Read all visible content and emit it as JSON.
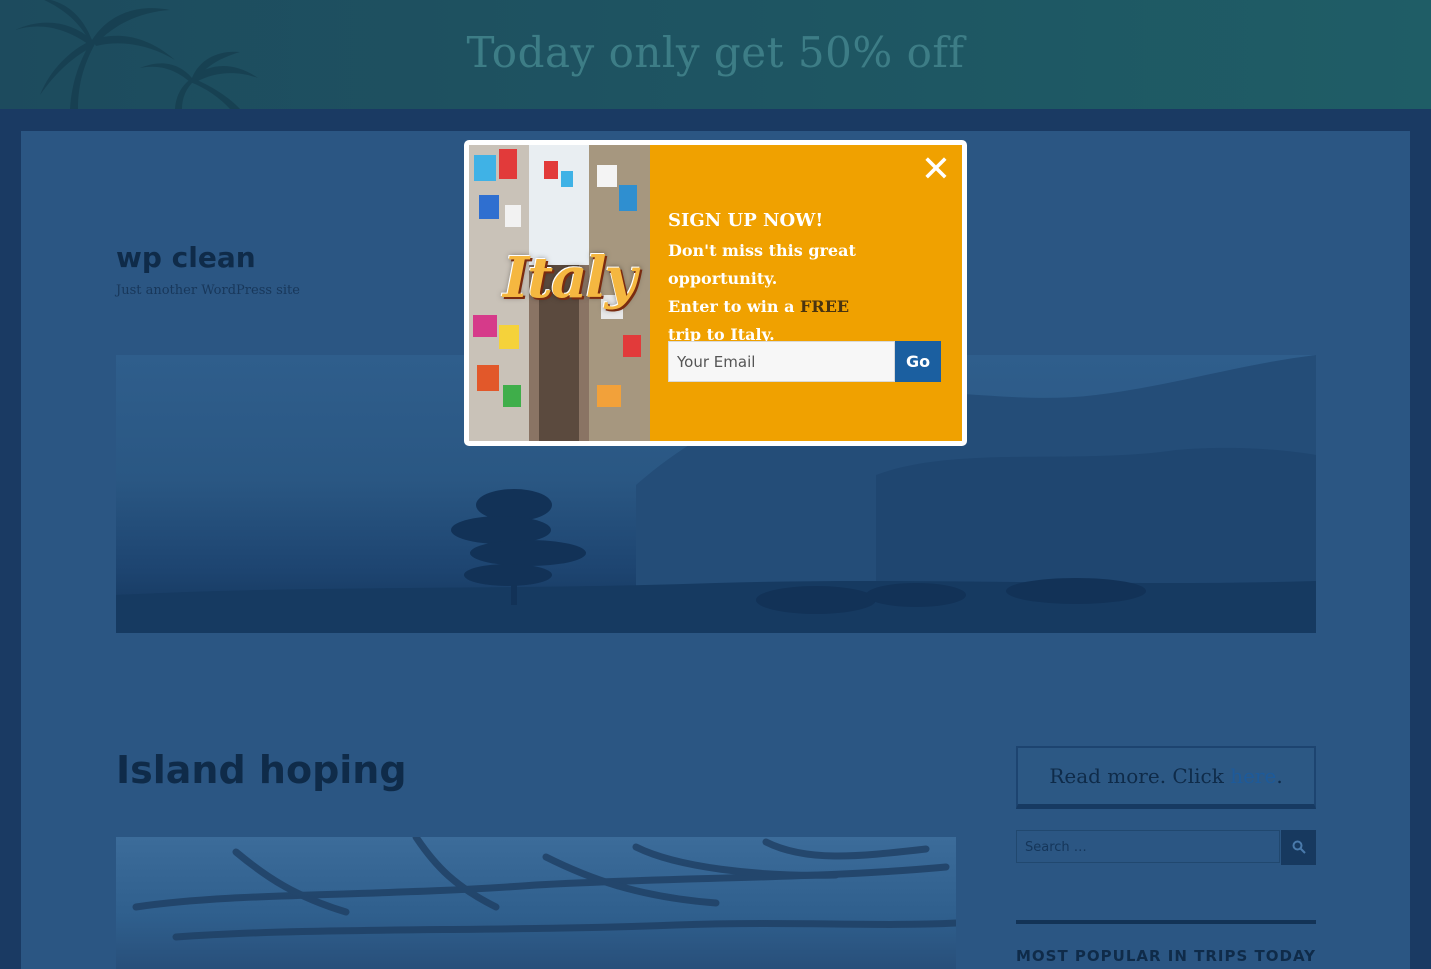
{
  "banner": {
    "text": "Today only get 50% off"
  },
  "site": {
    "title": "wp clean",
    "tagline": "Just another WordPress site"
  },
  "post": {
    "title": "Island hoping"
  },
  "sidebar": {
    "cta_prefix": "Read more. Click ",
    "cta_link": "here",
    "cta_suffix": ".",
    "search_placeholder": "Search …",
    "search_icon": "search-icon",
    "popular_heading": "MOST POPULAR IN TRIPS TODAY"
  },
  "popup": {
    "photo_word": "Italy",
    "close_icon": "close-icon",
    "headline": "SIGN UP NOW!",
    "line1": "Don't miss this great opportunity.",
    "line2_prefix": "Enter to win a ",
    "line2_emphasis": "FREE",
    "line3": "trip to Italy.",
    "email_placeholder": "Your Email",
    "submit_label": "Go",
    "accent_color": "#f0a100",
    "button_color": "#1b5fa0"
  }
}
